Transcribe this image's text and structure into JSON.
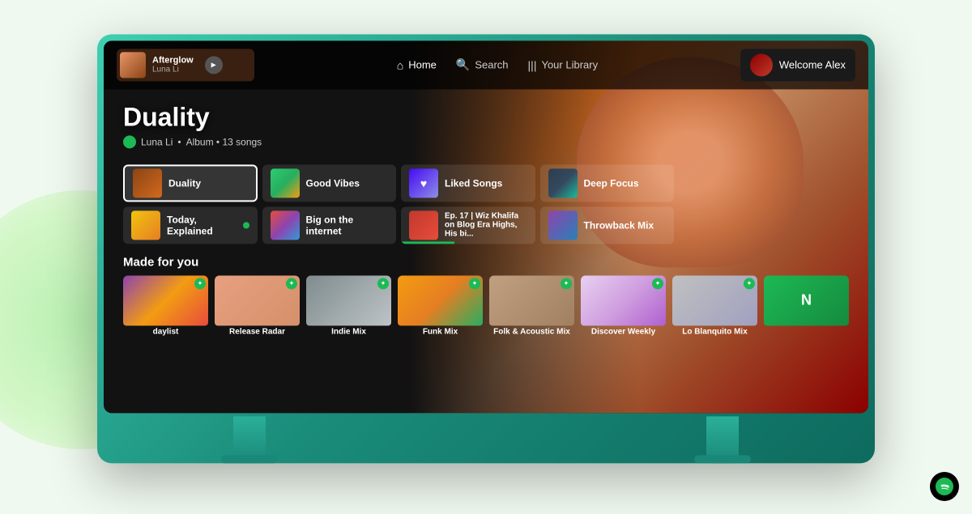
{
  "app": {
    "name": "Spotify TV"
  },
  "background": {
    "circle_color": "#b8f0b0"
  },
  "navbar": {
    "now_playing": {
      "title": "Afterglow",
      "artist": "Luna Li",
      "play_label": "▶"
    },
    "home_label": "Home",
    "search_label": "Search",
    "library_label": "Your Library",
    "welcome_label": "Welcome Alex"
  },
  "hero": {
    "title": "Duality",
    "artist": "Luna Li",
    "meta": "Album • 13 songs"
  },
  "quick_items": [
    {
      "label": "Duality",
      "active": true,
      "type": "album"
    },
    {
      "label": "Good Vibes",
      "active": false,
      "type": "playlist"
    },
    {
      "label": "Liked Songs",
      "active": false,
      "type": "liked"
    },
    {
      "label": "Deep Focus",
      "active": false,
      "type": "focus"
    },
    {
      "label": "Today, Explained",
      "active": false,
      "type": "podcast",
      "has_dot": true
    },
    {
      "label": "Big on the internet",
      "active": false,
      "type": "playlist"
    },
    {
      "label": "Ep. 17 | Wiz Khalifa on Blog Era Highs, His bi...",
      "active": false,
      "type": "podcast",
      "has_progress": true
    },
    {
      "label": "Throwback Mix",
      "active": false,
      "type": "mix"
    }
  ],
  "made_for_you": {
    "title": "Made for you",
    "items": [
      {
        "label": "daylist",
        "type": "daylist"
      },
      {
        "label": "Release Radar",
        "type": "release"
      },
      {
        "label": "Indie Mix",
        "type": "indie"
      },
      {
        "label": "Funk Mix",
        "type": "funk"
      },
      {
        "label": "Folk & Acoustic Mix",
        "type": "folk"
      },
      {
        "label": "Discover Weekly",
        "type": "discover"
      },
      {
        "label": "Lo Blanquito Mix",
        "type": "loblanquito"
      },
      {
        "label": "N",
        "type": "more"
      }
    ]
  }
}
